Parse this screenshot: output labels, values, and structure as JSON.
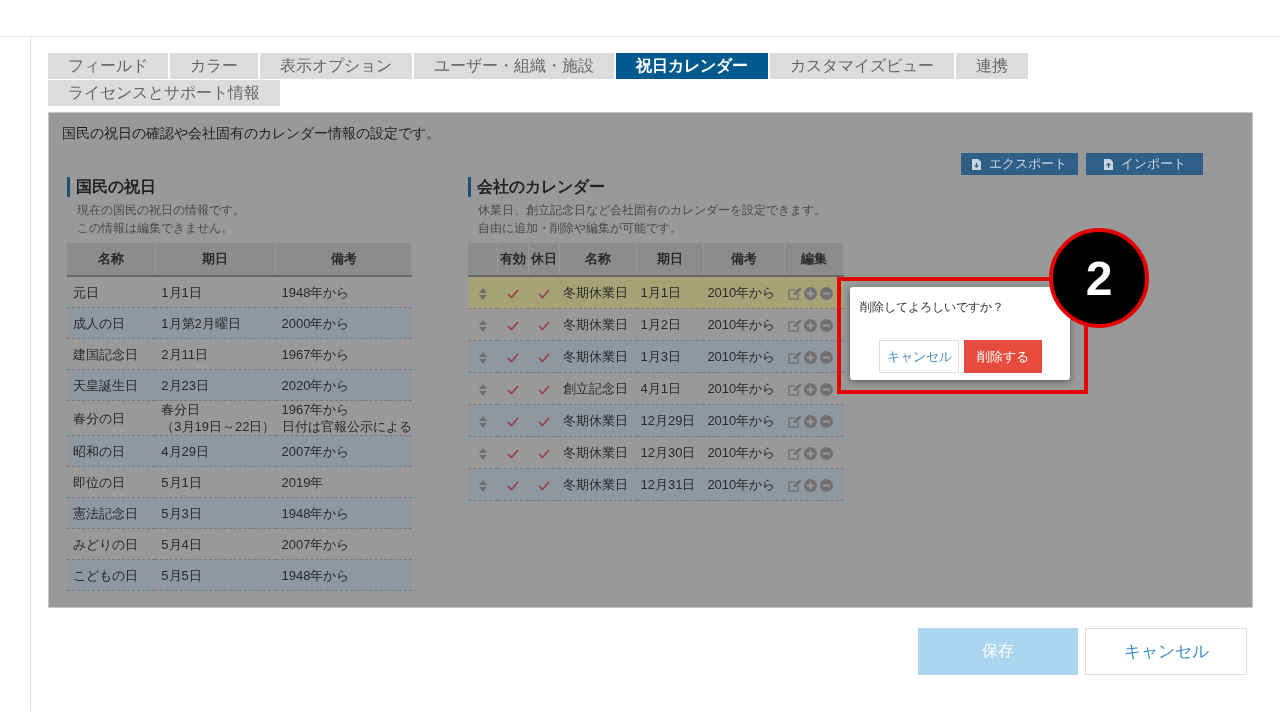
{
  "tabs": [
    {
      "label": "フィールド",
      "selected": false
    },
    {
      "label": "カラー",
      "selected": false
    },
    {
      "label": "表示オプション",
      "selected": false
    },
    {
      "label": "ユーザー・組織・施設",
      "selected": false
    },
    {
      "label": "祝日カレンダー",
      "selected": true
    },
    {
      "label": "カスタマイズビュー",
      "selected": false
    },
    {
      "label": "連携",
      "selected": false
    },
    {
      "label": "ライセンスとサポート情報",
      "selected": false
    }
  ],
  "panel": {
    "description": "国民の祝日の確認や会社固有のカレンダー情報の設定です。",
    "export_button": "エクスポート",
    "import_button": "インポート"
  },
  "national": {
    "title": "国民の祝日",
    "notes": [
      "現在の国民の祝日の情報です。",
      "この情報は編集できません。"
    ],
    "columns": [
      "名称",
      "期日",
      "備考"
    ],
    "rows": [
      {
        "name": "元日",
        "date": [
          "1月1日"
        ],
        "remark": [
          "1948年から"
        ]
      },
      {
        "name": "成人の日",
        "date": [
          "1月第2月曜日"
        ],
        "remark": [
          "2000年から"
        ]
      },
      {
        "name": "建国記念日",
        "date": [
          "2月11日"
        ],
        "remark": [
          "1967年から"
        ]
      },
      {
        "name": "天皇誕生日",
        "date": [
          "2月23日"
        ],
        "remark": [
          "2020年から"
        ]
      },
      {
        "name": "春分の日",
        "date": [
          "春分日",
          "（3月19日～22日）"
        ],
        "remark": [
          "1967年から",
          "日付は官報公示による"
        ]
      },
      {
        "name": "昭和の日",
        "date": [
          "4月29日"
        ],
        "remark": [
          "2007年から"
        ]
      },
      {
        "name": "即位の日",
        "date": [
          "5月1日"
        ],
        "remark": [
          "2019年"
        ]
      },
      {
        "name": "憲法記念日",
        "date": [
          "5月3日"
        ],
        "remark": [
          "1948年から"
        ]
      },
      {
        "name": "みどりの日",
        "date": [
          "5月4日"
        ],
        "remark": [
          "2007年から"
        ]
      },
      {
        "name": "こどもの日",
        "date": [
          "5月5日"
        ],
        "remark": [
          "1948年から"
        ]
      }
    ]
  },
  "company": {
    "title": "会社のカレンダー",
    "notes": [
      "休業日、創立記念日など会社固有のカレンダーを設定できます。",
      "自由に追加・削除や編集が可能です。"
    ],
    "columns": [
      "有効",
      "休日",
      "名称",
      "期日",
      "備考",
      "編集"
    ],
    "rows": [
      {
        "highlighted": true,
        "enabled": true,
        "holiday": true,
        "name": "冬期休業日",
        "date": "1月1日",
        "remark": "2010年から"
      },
      {
        "highlighted": false,
        "enabled": true,
        "holiday": true,
        "name": "冬期休業日",
        "date": "1月2日",
        "remark": "2010年から"
      },
      {
        "highlighted": false,
        "enabled": true,
        "holiday": true,
        "name": "冬期休業日",
        "date": "1月3日",
        "remark": "2010年から"
      },
      {
        "highlighted": false,
        "enabled": true,
        "holiday": true,
        "name": "創立記念日",
        "date": "4月1日",
        "remark": "2010年から"
      },
      {
        "highlighted": false,
        "enabled": true,
        "holiday": true,
        "name": "冬期休業日",
        "date": "12月29日",
        "remark": "2010年から"
      },
      {
        "highlighted": false,
        "enabled": true,
        "holiday": true,
        "name": "冬期休業日",
        "date": "12月30日",
        "remark": "2010年から"
      },
      {
        "highlighted": false,
        "enabled": true,
        "holiday": true,
        "name": "冬期休業日",
        "date": "12月31日",
        "remark": "2010年から"
      }
    ]
  },
  "dialog": {
    "message": "削除してよろしいですか？",
    "cancel_button": "キャンセル",
    "confirm_button": "削除する"
  },
  "annotation": {
    "marker": "2"
  },
  "footer": {
    "save_button": {
      "label": "保存",
      "disabled": true
    },
    "cancel_button": "キャンセル"
  }
}
